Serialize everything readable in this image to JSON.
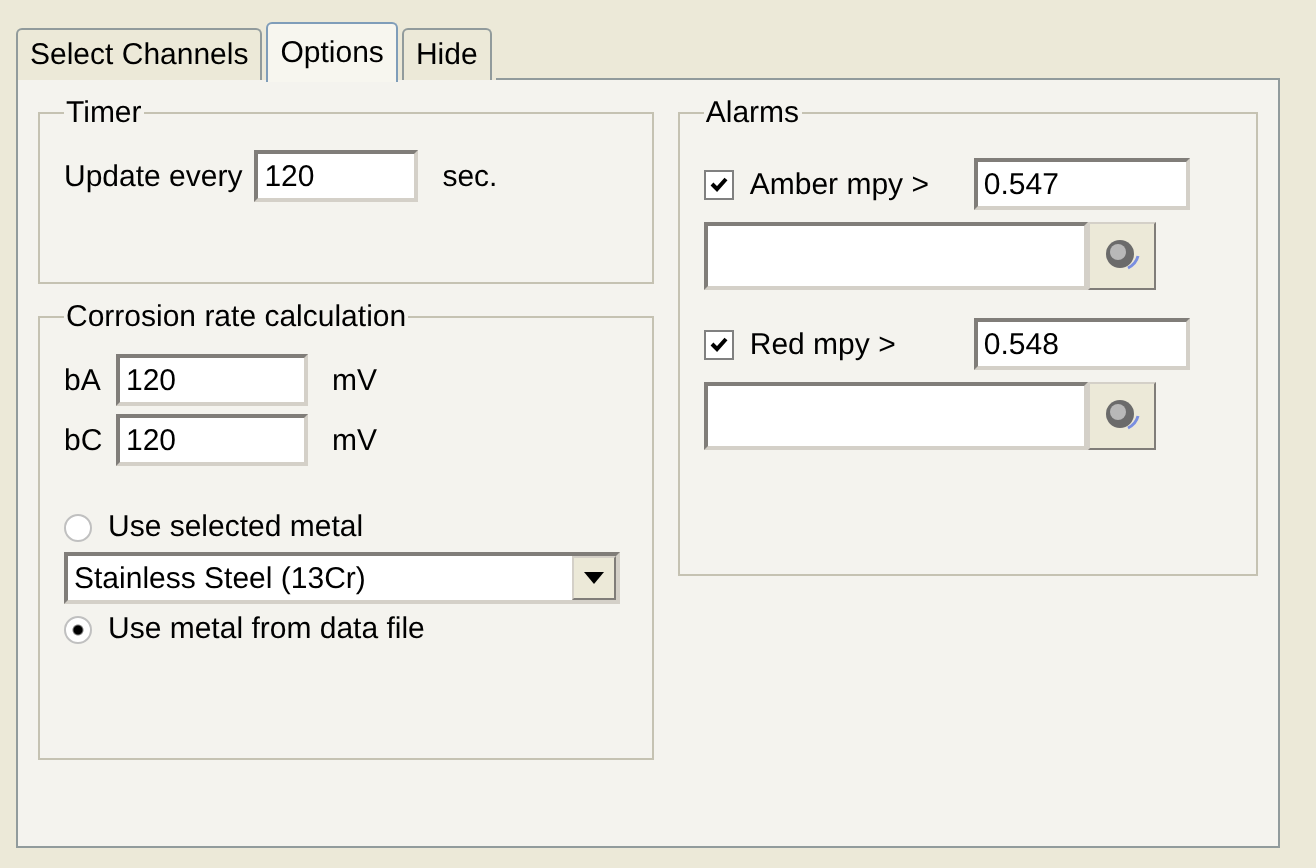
{
  "tabs": [
    {
      "label": "Select Channels",
      "selected": false
    },
    {
      "label": "Options",
      "selected": true
    },
    {
      "label": "Hide",
      "selected": false
    }
  ],
  "timer": {
    "title": "Timer",
    "label": "Update every",
    "value": "120",
    "unit": "sec."
  },
  "corrosion": {
    "title": "Corrosion rate calculation",
    "fields": [
      {
        "label": "bA",
        "value": "120",
        "unit": "mV"
      },
      {
        "label": "bC",
        "value": "120",
        "unit": "mV"
      }
    ],
    "radio_selected_metal": {
      "label": "Use selected metal",
      "selected": false
    },
    "metal_dropdown": {
      "value": "Stainless Steel (13Cr)"
    },
    "radio_data_file": {
      "label": "Use metal from data file",
      "selected": true
    }
  },
  "alarms": {
    "title": "Alarms",
    "items": [
      {
        "label": "Amber mpy >",
        "checked": true,
        "value": "0.547"
      },
      {
        "label": "Red mpy >",
        "checked": true,
        "value": "0.548"
      }
    ]
  }
}
